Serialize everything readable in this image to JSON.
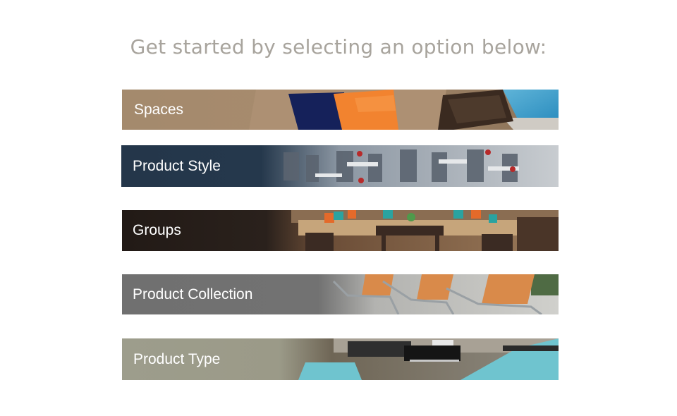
{
  "heading": "Get started by selecting an option below:",
  "options": [
    {
      "label": "Spaces",
      "base_color": "#a48a6d"
    },
    {
      "label": "Product Style",
      "base_color": "#24364a"
    },
    {
      "label": "Groups",
      "base_color": "#221a16"
    },
    {
      "label": "Product Collection",
      "base_color": "#707070"
    },
    {
      "label": "Product Type",
      "base_color": "#9d9d8c"
    }
  ]
}
